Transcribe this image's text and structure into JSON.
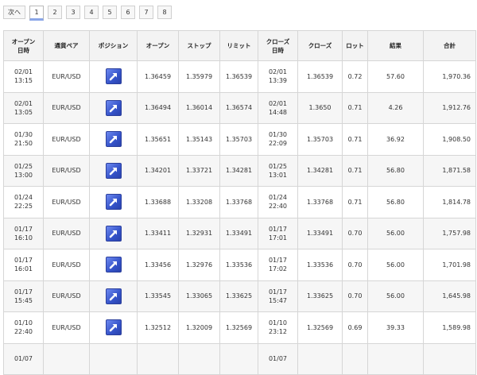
{
  "pager": {
    "next_label": "次へ",
    "pages": [
      "1",
      "2",
      "3",
      "4",
      "5",
      "6",
      "7",
      "8"
    ],
    "active": "1"
  },
  "table": {
    "headers": [
      "オープン\n日時",
      "通貨ペア",
      "ポジション",
      "オープン",
      "ストップ",
      "リミット",
      "クローズ\n日時",
      "クローズ",
      "ロット",
      "結果",
      "合計"
    ],
    "position_icon": "arrow-up-right-icon",
    "rows": [
      {
        "open_date": "02/01",
        "open_time": "13:15",
        "pair": "EUR/USD",
        "open": "1.36459",
        "stop": "1.35979",
        "limit": "1.36539",
        "close_date": "02/01",
        "close_time": "13:39",
        "close": "1.36539",
        "lot": "0.72",
        "result": "57.60",
        "total": "1,970.36"
      },
      {
        "open_date": "02/01",
        "open_time": "13:05",
        "pair": "EUR/USD",
        "open": "1.36494",
        "stop": "1.36014",
        "limit": "1.36574",
        "close_date": "02/01",
        "close_time": "14:48",
        "close": "1.3650",
        "lot": "0.71",
        "result": "4.26",
        "total": "1,912.76"
      },
      {
        "open_date": "01/30",
        "open_time": "21:50",
        "pair": "EUR/USD",
        "open": "1.35651",
        "stop": "1.35143",
        "limit": "1.35703",
        "close_date": "01/30",
        "close_time": "22:09",
        "close": "1.35703",
        "lot": "0.71",
        "result": "36.92",
        "total": "1,908.50"
      },
      {
        "open_date": "01/25",
        "open_time": "13:00",
        "pair": "EUR/USD",
        "open": "1.34201",
        "stop": "1.33721",
        "limit": "1.34281",
        "close_date": "01/25",
        "close_time": "13:01",
        "close": "1.34281",
        "lot": "0.71",
        "result": "56.80",
        "total": "1,871.58"
      },
      {
        "open_date": "01/24",
        "open_time": "22:25",
        "pair": "EUR/USD",
        "open": "1.33688",
        "stop": "1.33208",
        "limit": "1.33768",
        "close_date": "01/24",
        "close_time": "22:40",
        "close": "1.33768",
        "lot": "0.71",
        "result": "56.80",
        "total": "1,814.78"
      },
      {
        "open_date": "01/17",
        "open_time": "16:10",
        "pair": "EUR/USD",
        "open": "1.33411",
        "stop": "1.32931",
        "limit": "1.33491",
        "close_date": "01/17",
        "close_time": "17:01",
        "close": "1.33491",
        "lot": "0.70",
        "result": "56.00",
        "total": "1,757.98"
      },
      {
        "open_date": "01/17",
        "open_time": "16:01",
        "pair": "EUR/USD",
        "open": "1.33456",
        "stop": "1.32976",
        "limit": "1.33536",
        "close_date": "01/17",
        "close_time": "17:02",
        "close": "1.33536",
        "lot": "0.70",
        "result": "56.00",
        "total": "1,701.98"
      },
      {
        "open_date": "01/17",
        "open_time": "15:45",
        "pair": "EUR/USD",
        "open": "1.33545",
        "stop": "1.33065",
        "limit": "1.33625",
        "close_date": "01/17",
        "close_time": "15:47",
        "close": "1.33625",
        "lot": "0.70",
        "result": "56.00",
        "total": "1,645.98"
      },
      {
        "open_date": "01/10",
        "open_time": "22:40",
        "pair": "EUR/USD",
        "open": "1.32512",
        "stop": "1.32009",
        "limit": "1.32569",
        "close_date": "01/10",
        "close_time": "23:12",
        "close": "1.32569",
        "lot": "0.69",
        "result": "39.33",
        "total": "1,589.98"
      },
      {
        "open_date": "01/07",
        "open_time": "",
        "pair": "",
        "open": "",
        "stop": "",
        "limit": "",
        "close_date": "01/07",
        "close_time": "",
        "close": "",
        "lot": "",
        "result": "",
        "total": ""
      }
    ]
  }
}
